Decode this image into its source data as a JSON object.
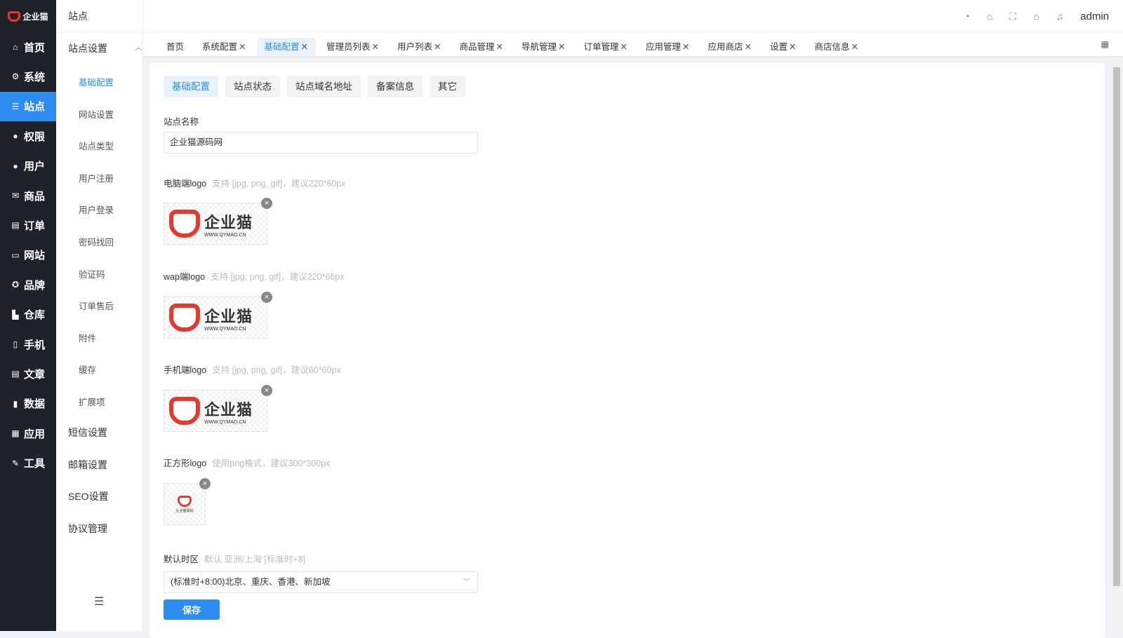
{
  "brand": {
    "name": "企业猫"
  },
  "nav": [
    {
      "label": "首页",
      "icon": "home-icon",
      "g": "⌂"
    },
    {
      "label": "系统",
      "icon": "gear-icon",
      "g": "⚙"
    },
    {
      "label": "站点",
      "icon": "sliders-icon",
      "g": "☰"
    },
    {
      "label": "权限",
      "icon": "user-lock-icon",
      "g": "●"
    },
    {
      "label": "用户",
      "icon": "user-icon",
      "g": "●"
    },
    {
      "label": "商品",
      "icon": "mail-icon",
      "g": "✉"
    },
    {
      "label": "订单",
      "icon": "clipboard-icon",
      "g": "▤"
    },
    {
      "label": "网站",
      "icon": "monitor-icon",
      "g": "▭"
    },
    {
      "label": "品牌",
      "icon": "award-icon",
      "g": "✪"
    },
    {
      "label": "仓库",
      "icon": "warehouse-icon",
      "g": "▙"
    },
    {
      "label": "手机",
      "icon": "phone-icon",
      "g": "▯"
    },
    {
      "label": "文章",
      "icon": "article-icon",
      "g": "▤"
    },
    {
      "label": "数据",
      "icon": "chart-icon",
      "g": "▮"
    },
    {
      "label": "应用",
      "icon": "apps-icon",
      "g": "▦"
    },
    {
      "label": "工具",
      "icon": "wrench-icon",
      "g": "✎"
    }
  ],
  "sub": {
    "title": "站点",
    "group": "站点设置",
    "items": [
      "基础配置",
      "网站设置",
      "站点类型",
      "用户注册",
      "用户登录",
      "密码找回",
      "验证码",
      "订单售后",
      "附件",
      "缓存",
      "扩展项"
    ],
    "groups": [
      "短信设置",
      "邮箱设置",
      "SEO设置",
      "协议管理"
    ]
  },
  "header": {
    "user": "admin"
  },
  "tabs": [
    "首页",
    "系统配置",
    "基础配置",
    "管理员列表",
    "用户列表",
    "商品管理",
    "导航管理",
    "订单管理",
    "应用管理",
    "应用商店",
    "设置",
    "商店信息"
  ],
  "subtabs": [
    "基础配置",
    "站点状态",
    "站点域名地址",
    "备案信息",
    "其它"
  ],
  "form": {
    "site_name_label": "站点名称",
    "site_name": "企业猫源码网",
    "pc_logo_label": "电脑端logo",
    "pc_logo_hint": "支持 [jpg, png, gif]，建议220*60px",
    "wap_logo_label": "wap端logo",
    "wap_logo_hint": "支持 [jpg, png, gif]，建议220*66px",
    "mobile_logo_label": "手机端logo",
    "mobile_logo_hint": "支持 [jpg, png, gif]，建议60*60px",
    "square_logo_label": "正方形logo",
    "square_logo_hint": "使用png格式，建议300*300px",
    "logo_text": "企业猫",
    "logo_url": "WWW.QYMAO.CN",
    "square_logo_text": "企业猫源码",
    "tz_label": "默认时区",
    "tz_hint": "默认 亚洲/上海 [标准时+8]",
    "tz_value": "(标准时+8:00)北京、重庆、香港、新加坡",
    "save": "保存"
  },
  "colors": {
    "primary": "#2d8cf0",
    "sidebar": "#1f2329"
  }
}
